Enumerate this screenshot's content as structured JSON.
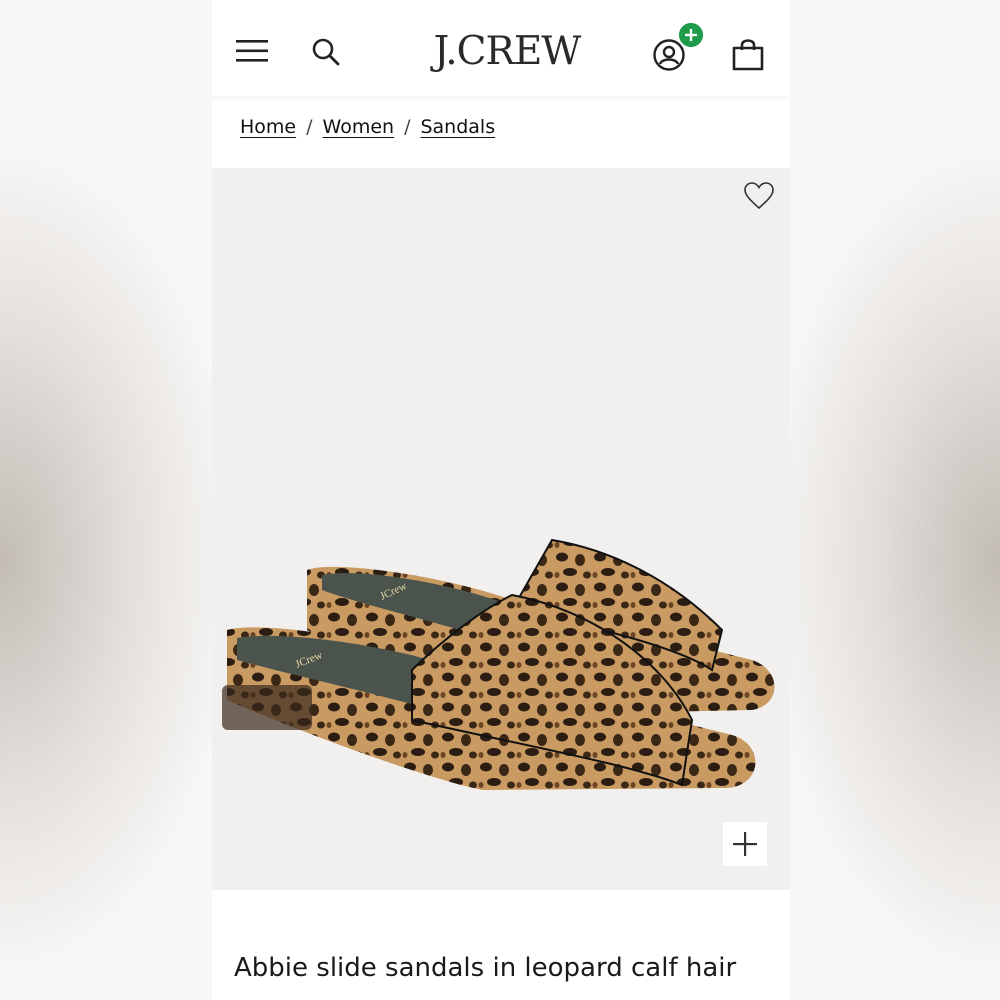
{
  "header": {
    "logo_text": "J.CREW",
    "icons": {
      "menu": "hamburger-menu-icon",
      "search": "search-icon",
      "account": "account-icon",
      "account_badge": "plus-badge",
      "bag": "shopping-bag-icon"
    },
    "badge_color": "#1f9a48"
  },
  "breadcrumb": {
    "items": [
      "Home",
      "Women",
      "Sandals"
    ],
    "separator": "/"
  },
  "product": {
    "image_alt_icon": "leopard-slide-sandals",
    "wishlist_icon": "heart-icon",
    "zoom_icon": "plus-icon",
    "title": "Abbie slide sandals in leopard calf hair"
  },
  "colors": {
    "text": "#1a1a1a",
    "image_bg": "#f1f0ef"
  }
}
